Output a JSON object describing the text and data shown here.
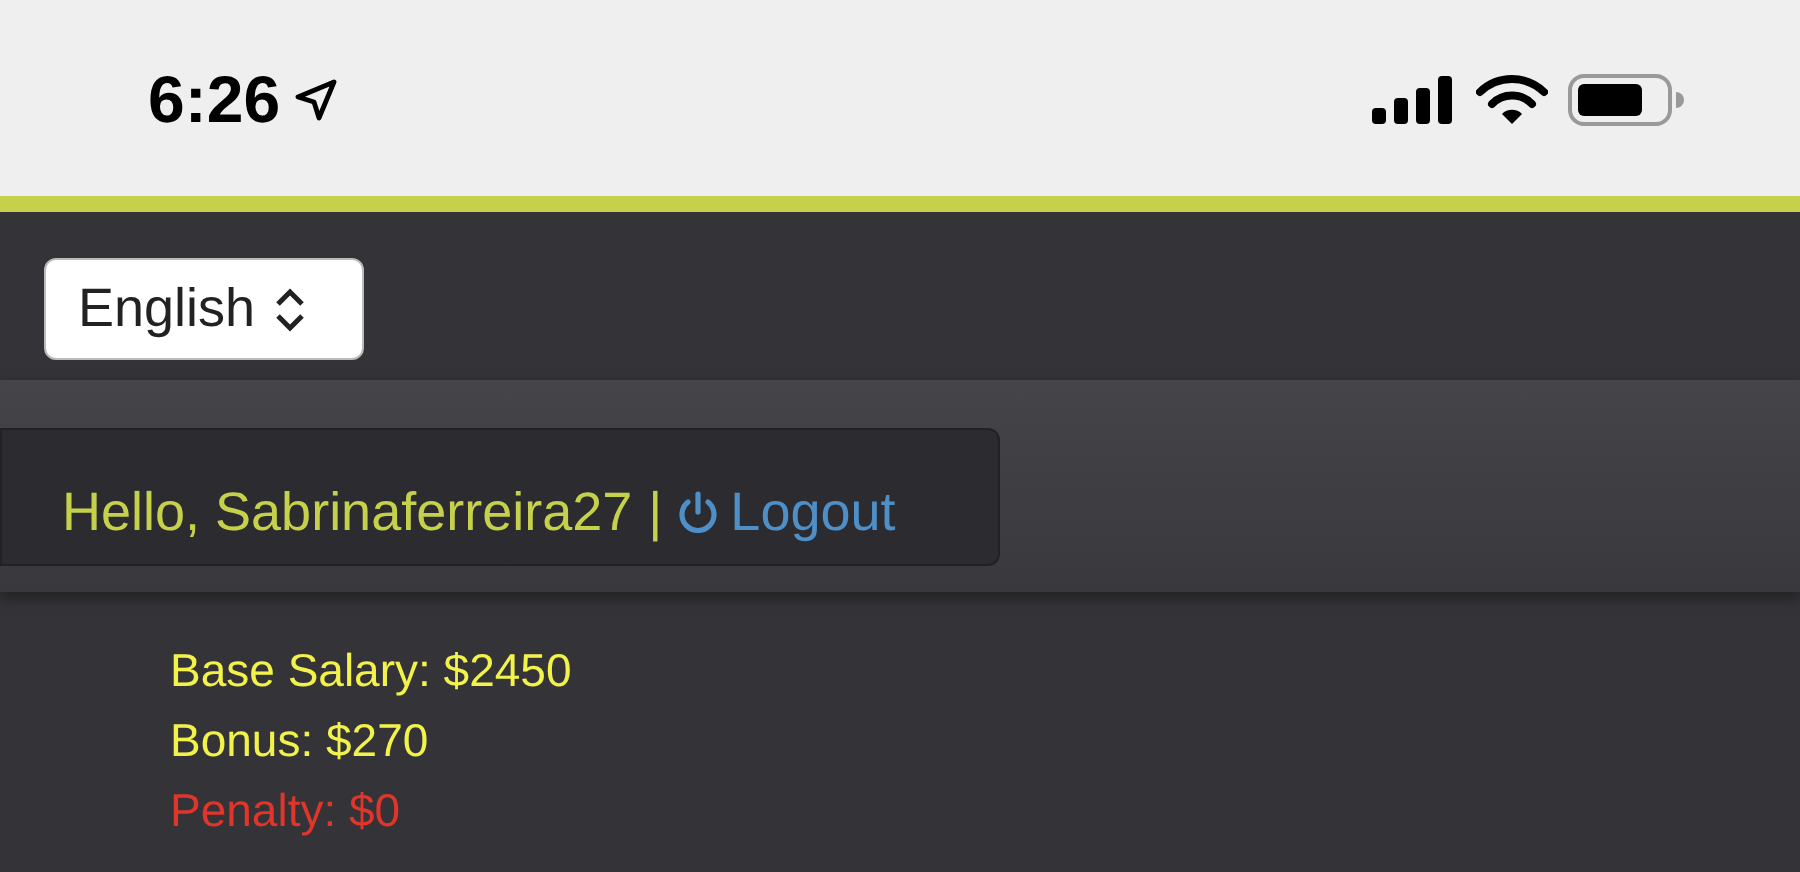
{
  "status_bar": {
    "time": "6:26"
  },
  "language_select": {
    "value": "English"
  },
  "header": {
    "greeting": "Hello, Sabrinaferreira27",
    "separator": "|",
    "logout": "Logout"
  },
  "salary_lines": [
    {
      "text": "Base Salary: $2450",
      "kind": "earning"
    },
    {
      "text": "Bonus: $270",
      "kind": "earning"
    },
    {
      "text": "Penalty: $0",
      "kind": "penalty"
    }
  ]
}
